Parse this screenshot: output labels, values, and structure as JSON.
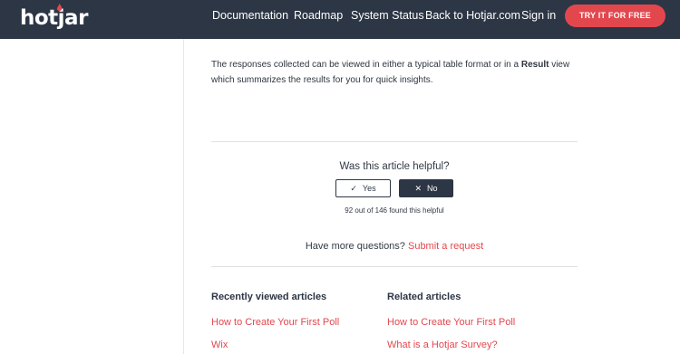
{
  "header": {
    "logo_text": "hotjar",
    "nav": [
      {
        "label": "Documentation"
      },
      {
        "label": "Roadmap"
      },
      {
        "label": "System Status"
      },
      {
        "label": "Back to Hotjar.com"
      },
      {
        "label": "Sign in"
      }
    ],
    "cta_label": "TRY IT FOR FREE"
  },
  "article": {
    "paragraph_part1": "The responses collected can be viewed in either a typical table format or in a ",
    "paragraph_bold": "Result",
    "paragraph_part2": " view which summarizes the results for you for quick insights."
  },
  "feedback": {
    "question": "Was this article helpful?",
    "yes_label": "Yes",
    "no_label": "No",
    "yes_icon": "check-icon",
    "no_icon": "x-icon",
    "count_text": "92 out of 146 found this helpful"
  },
  "more_questions": {
    "text": "Have more questions?",
    "link": "Submit a request"
  },
  "recently_viewed": {
    "title": "Recently viewed articles",
    "items": [
      "How to Create Your First Poll",
      "Wix"
    ]
  },
  "related": {
    "title": "Related articles",
    "items": [
      "How to Create Your First Poll",
      "What is a Hotjar Survey?"
    ]
  },
  "colors": {
    "header_bg": "#2d3645",
    "accent": "#e3474e",
    "text": "#323a45"
  }
}
